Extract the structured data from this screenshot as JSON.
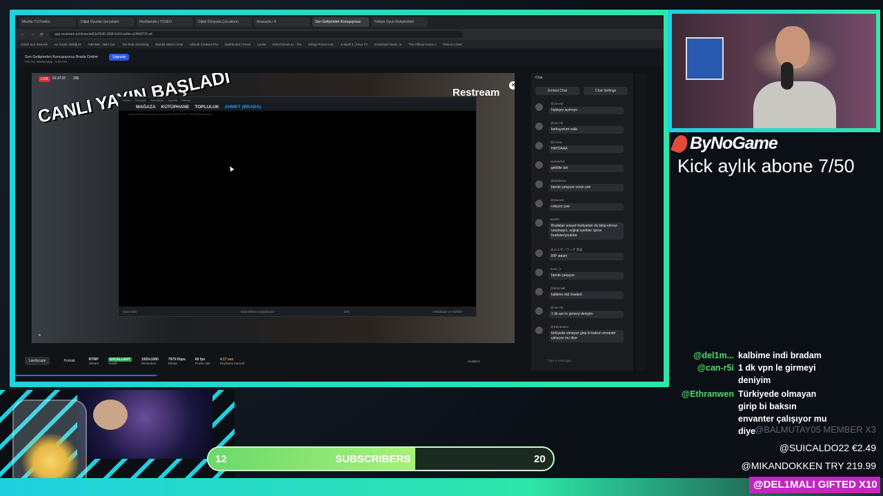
{
  "browser": {
    "tabs": [
      "Mozilla 7.0 Firefox",
      "Dijital Oyunlar Gerçekten",
      "Heshiarndo | TOSEO",
      "Dijital Dünyada Çocukların",
      "Anasayfa / X",
      "Son Gelişmeleri Konuşuyoruz",
      "Türkiye Oyun Geliştiricileri"
    ],
    "url": "app.restream.io/showcfe63e2545-368f-4c54-ad4e-a1f6f0f72f ed",
    "bookmarks": [
      "Gönül Son Severek",
      "Az Kişinin Bildiği M.",
      "NBABile - NBA Gre",
      "The best streaming",
      "Bandai Namco Ente",
      "Ubisoft Creators Pro",
      "Dashboard | Prezii",
      "Lunkit",
      "RetroGames.cc - Pla",
      "eShop-Prices.com",
      "S Sport 2 | Zeus TV",
      "Download music, m",
      "The Official Home o",
      "Patreon | festi"
    ],
    "page_title": "Son Gelişmeleri Konuşuyoruz Brada Online",
    "page_subtitle": "Feb 04, Wednesday · 8:30 PM",
    "upgrade": "Upgrade"
  },
  "video": {
    "live_badge": "LIVE",
    "timer": "01:37:37",
    "viewers": "150",
    "overlay_text": "CANLI YAYIN BAŞLADI",
    "restream_label": "Restream",
    "close": "✕"
  },
  "steam": {
    "top_menu": [
      "Steam",
      "Görünüm",
      "Arkadaşlar",
      "Oyunlar",
      "Yardım"
    ],
    "nav": [
      "MAĞAZA",
      "KÜTÜPHANE",
      "TOPLULUK",
      "AHMET (BRADA)"
    ],
    "url": "https://steamcommunity.com/profiles/76561198177051085/inventory/",
    "bottom_left": "Oyun Ekle",
    "bottom_center": "Güncelleme Uygulanıyor",
    "bottom_pct": "32%",
    "bottom_right": "Arkadaşlar ve Sohbet"
  },
  "stats": {
    "landscape": "Landscape",
    "portrait": "Portrait",
    "rtmp_label": "RTMP",
    "rtmp_sub": "Stream",
    "health_label": "EXCELLENT",
    "health_sub": "Health",
    "res": "1920x1080",
    "res_sub": "Resolution",
    "bitrate": "7979 Kbps",
    "bitrate_sub": "Bitrate",
    "fps": "60 fps",
    "fps_sub": "Frame rate",
    "keyframe": "4.17 sec",
    "keyframe_sub": "Keyframe interval",
    "analytics": "Analytics"
  },
  "chat": {
    "header": "Chat",
    "embed": "Embed Chat",
    "settings": "Chat Settings",
    "messages": [
      {
        "user": "@can-r5i",
        "text": "hiçbişey açılmıyo"
      },
      {
        "user": "@can-r5i",
        "text": "korkuyorum valla"
      },
      {
        "user": "@Asreq",
        "text": "HAYDAAA"
      },
      {
        "user": "KartalVR2",
        "text": "geldiler abi"
      },
      {
        "user": "@kubb5SZ",
        "text": "bende çalışıyor sorun yok"
      },
      {
        "user": "@starone",
        "text": "noluyor yaw"
      },
      {
        "user": "BotRix",
        "text": "Bradaları sosyal modyadan da takip etmeyi unutmayın. orijinal içerikler içinse bradalar/youtube"
      },
      {
        "user": "@エルザンラング 黒猫",
        "text": "RIP steam"
      },
      {
        "user": "wanz_h",
        "text": "bende çalışıyor."
      },
      {
        "user": "@del1mall",
        "text": "kalbime indi bradam"
      },
      {
        "user": "@can-r5i",
        "text": "1 dk vpn le girmeyi deniyim"
      },
      {
        "user": "@Ethranwen",
        "text": "türkiyede olmayan girip bi baksın envanter çalışıyor mu diye"
      }
    ],
    "input_placeholder": "Type a message..."
  },
  "brand": {
    "name": "ByNoGame",
    "kick_goal": "Kick aylık abone 7/50"
  },
  "overlay_chat": [
    {
      "user": "@del1m...",
      "text": "kalbime indi bradam"
    },
    {
      "user": "@can-r5i",
      "text": "1 dk vpn le girmeyi deniyim"
    },
    {
      "user": "@Ethranwen",
      "text": "Türkiyede olmayan girip bi baksın envanter çalışıyor mu diye"
    }
  ],
  "donations": {
    "member": "@BALMUTAY05  MEMBER X3",
    "d1": "@SUICALDO22  €2.49",
    "d2": "@MIKANDOKKEN  TRY 219.99",
    "gifted": "@DEL1MALI  GIFTED X10"
  },
  "sub_goal": {
    "left": "12",
    "label": "SUBSCRIBERS",
    "right": "20",
    "progress": 0.6
  },
  "colors": {
    "accent": "#1fd0e0",
    "green": "#2ee6a8",
    "gift": "#c027c0",
    "live": "#e0283a"
  }
}
